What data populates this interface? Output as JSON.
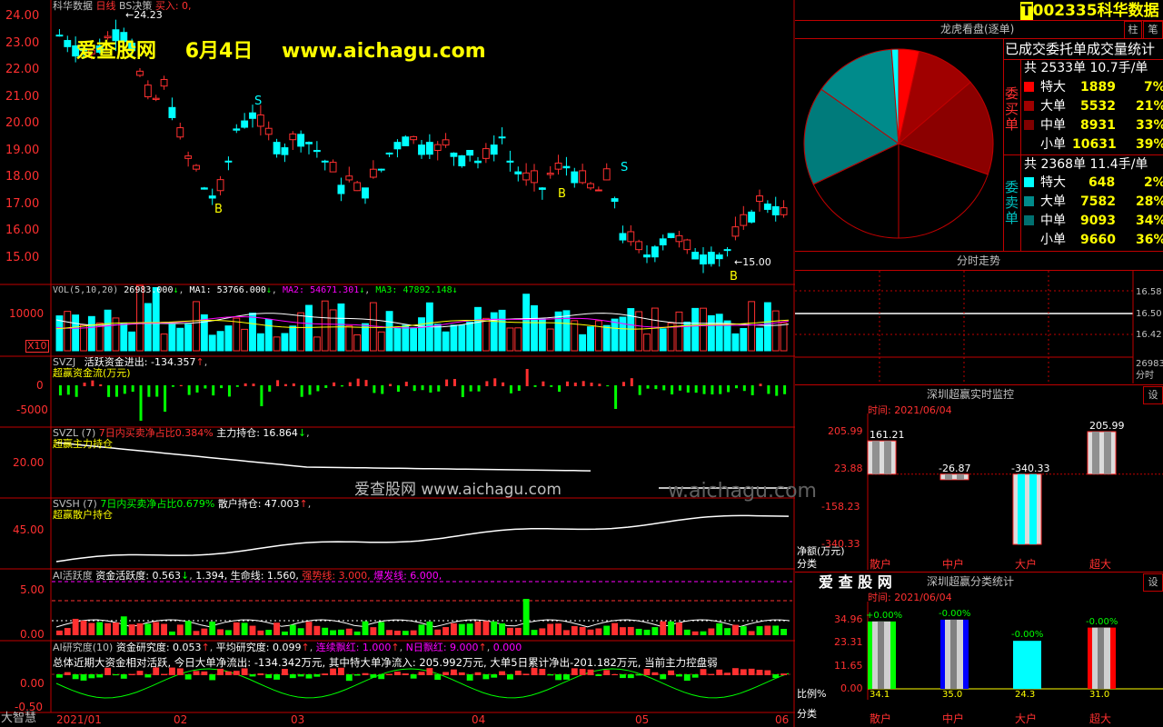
{
  "stock": {
    "code": "002335",
    "name": "科华数据",
    "badge": "T"
  },
  "main_chart": {
    "header": {
      "name": "科华数据",
      "period": "日线",
      "indicator": "BS决策",
      "buy_label": "买入: 0,"
    },
    "high_label": "24.23",
    "low_label": "15.00",
    "y_ticks": [
      "24.00",
      "23.00",
      "22.00",
      "21.00",
      "20.00",
      "19.00",
      "18.00",
      "17.00",
      "16.00",
      "15.00"
    ],
    "signals": [
      "S",
      "S",
      "B",
      "B",
      "B"
    ],
    "watermark": {
      "site_name": "爱查股网",
      "date": "6月4日",
      "url": "www.aichagu.com"
    }
  },
  "vol_panel": {
    "label": "VOL(5,10,20)",
    "vol": "26983.000",
    "ma1_label": "MA1:",
    "ma1": "53766.000",
    "ma2_label": "MA2:",
    "ma2": "54671.301",
    "ma3_label": "MA3:",
    "ma3": "47892.148",
    "y_tick": "10000",
    "unit": "X10"
  },
  "svzj_panel": {
    "label": "SVZJ",
    "text": "活跃资金进出: -134.357",
    "sub": "超赢资金流(万元)",
    "ticks": [
      "0",
      "-5000"
    ]
  },
  "svzl_panel": {
    "label": "SVZL",
    "param": "(7)",
    "desc": "7日内买卖净占比0.384%",
    "hold": "主力持仓: 16.864",
    "sub": "超赢主力持仓",
    "tick": "20.00"
  },
  "svsh_panel": {
    "label": "SVSH",
    "param": "(7)",
    "desc": "7日内买卖净占比0.679%",
    "hold": "散户持仓: 47.003",
    "sub": "超赢散户持仓",
    "tick": "45.00"
  },
  "ai_active": {
    "label": "AI活跃度",
    "fund": "资金活跃度: 0.563",
    "v2": "1.394,",
    "life": "生命线: 1.560,",
    "strong": "强势线: 3.000,",
    "burst": "爆发线: 6.000,",
    "ticks": [
      "5.00",
      "0.00"
    ]
  },
  "ai_research": {
    "label": "AI研究度(10)",
    "fund": "资金研究度: 0.053",
    "avg": "平均研究度: 0.099",
    "cont": "连续飘红: 1.000",
    "nday": "N日飘红: 9.000",
    "last": "0.000",
    "summary": "总体近期大资金相对活跃, 今日大单净流出: -134.342万元, 其中特大单净流入: 205.992万元, 大单5日累计净出-201.182万元, 当前主力控盘弱",
    "ticks": [
      "0.00",
      "-0.50"
    ]
  },
  "watermark2": "爱查股网    www.aichagu.com",
  "watermark2b": "w.aichagu.com",
  "xaxis": {
    "labels": [
      "2021/01",
      "02",
      "03",
      "04",
      "05",
      "06"
    ],
    "brand": "大智慧"
  },
  "right": {
    "top_buttons": [
      "柱",
      "笔"
    ],
    "pie_title": "龙虎看盘(逐单)",
    "stats_title": "已成交委托单成交量统计",
    "buy_label": "委买单",
    "sell_label": "委卖单",
    "buy_total": "共 2533单 10.7手/单",
    "sell_total": "共 2368单 11.4手/单",
    "buy_rows": [
      {
        "name": "特大",
        "count": "1889",
        "pct": "7%",
        "color": "#ff0000"
      },
      {
        "name": "大单",
        "count": "5532",
        "pct": "21%",
        "color": "#a00000"
      },
      {
        "name": "中单",
        "count": "8931",
        "pct": "33%",
        "color": "#800000"
      },
      {
        "name": "小单",
        "count": "10631",
        "pct": "39%",
        "color": "#000000"
      }
    ],
    "sell_rows": [
      {
        "name": "特大",
        "count": "648",
        "pct": "2%",
        "color": "#00ffff"
      },
      {
        "name": "大单",
        "count": "7582",
        "pct": "28%",
        "color": "#008b8b"
      },
      {
        "name": "中单",
        "count": "9093",
        "pct": "34%",
        "color": "#007070"
      },
      {
        "name": "小单",
        "count": "9660",
        "pct": "36%",
        "color": "#000000"
      }
    ],
    "pie_slices": [
      {
        "label": "特大买",
        "value": 1889,
        "color": "#ff0000"
      },
      {
        "label": "大单买",
        "value": 5532,
        "color": "#a00000"
      },
      {
        "label": "中单买",
        "value": 8931,
        "color": "#8b0000"
      },
      {
        "label": "小单买",
        "value": 10631,
        "color": "#000000"
      },
      {
        "label": "小单卖",
        "value": 9660,
        "color": "#000000"
      },
      {
        "label": "中单卖",
        "value": 9093,
        "color": "#007b7b"
      },
      {
        "label": "大单卖",
        "value": 7582,
        "color": "#008b8b"
      },
      {
        "label": "特大卖",
        "value": 648,
        "color": "#00ffff"
      }
    ],
    "intraday": {
      "title": "分时走势",
      "ticks": [
        "16.58",
        "16.50",
        "16.42"
      ],
      "vol": "26983",
      "vol_unit": "分时"
    },
    "monitor": {
      "title": "深圳超赢实时监控",
      "btn": "设",
      "time_label": "时间: 2021/06/04",
      "ticks": [
        "205.99",
        "23.88",
        "-158.23",
        "-340.33"
      ],
      "ylabel": "净额(万元)",
      "xlabel": "分类",
      "categories": [
        "散户",
        "中户",
        "大户",
        "超大"
      ],
      "values": [
        161.21,
        -26.87,
        -340.33,
        205.99
      ],
      "value_labels": [
        "161.21",
        "-26.87",
        "-340.33",
        "205.99"
      ]
    },
    "classify": {
      "brand": "爱 查 股 网",
      "title": "深圳超赢分类统计",
      "btn": "设",
      "time_label": "时间: 2021/06/04",
      "ticks": [
        "34.96",
        "23.31",
        "11.65",
        "0.00"
      ],
      "ylabel": "比例%",
      "xlabel": "分类",
      "categories": [
        "散户",
        "中户",
        "大户",
        "超大"
      ],
      "values": [
        34.1,
        35.0,
        24.3,
        31.0
      ],
      "value_labels": [
        "34.1",
        "35.0",
        "24.3",
        "31.0"
      ],
      "change_labels": [
        "+0.00%",
        "-0.00%",
        "-0.00%",
        "-0.00%"
      ]
    }
  }
}
